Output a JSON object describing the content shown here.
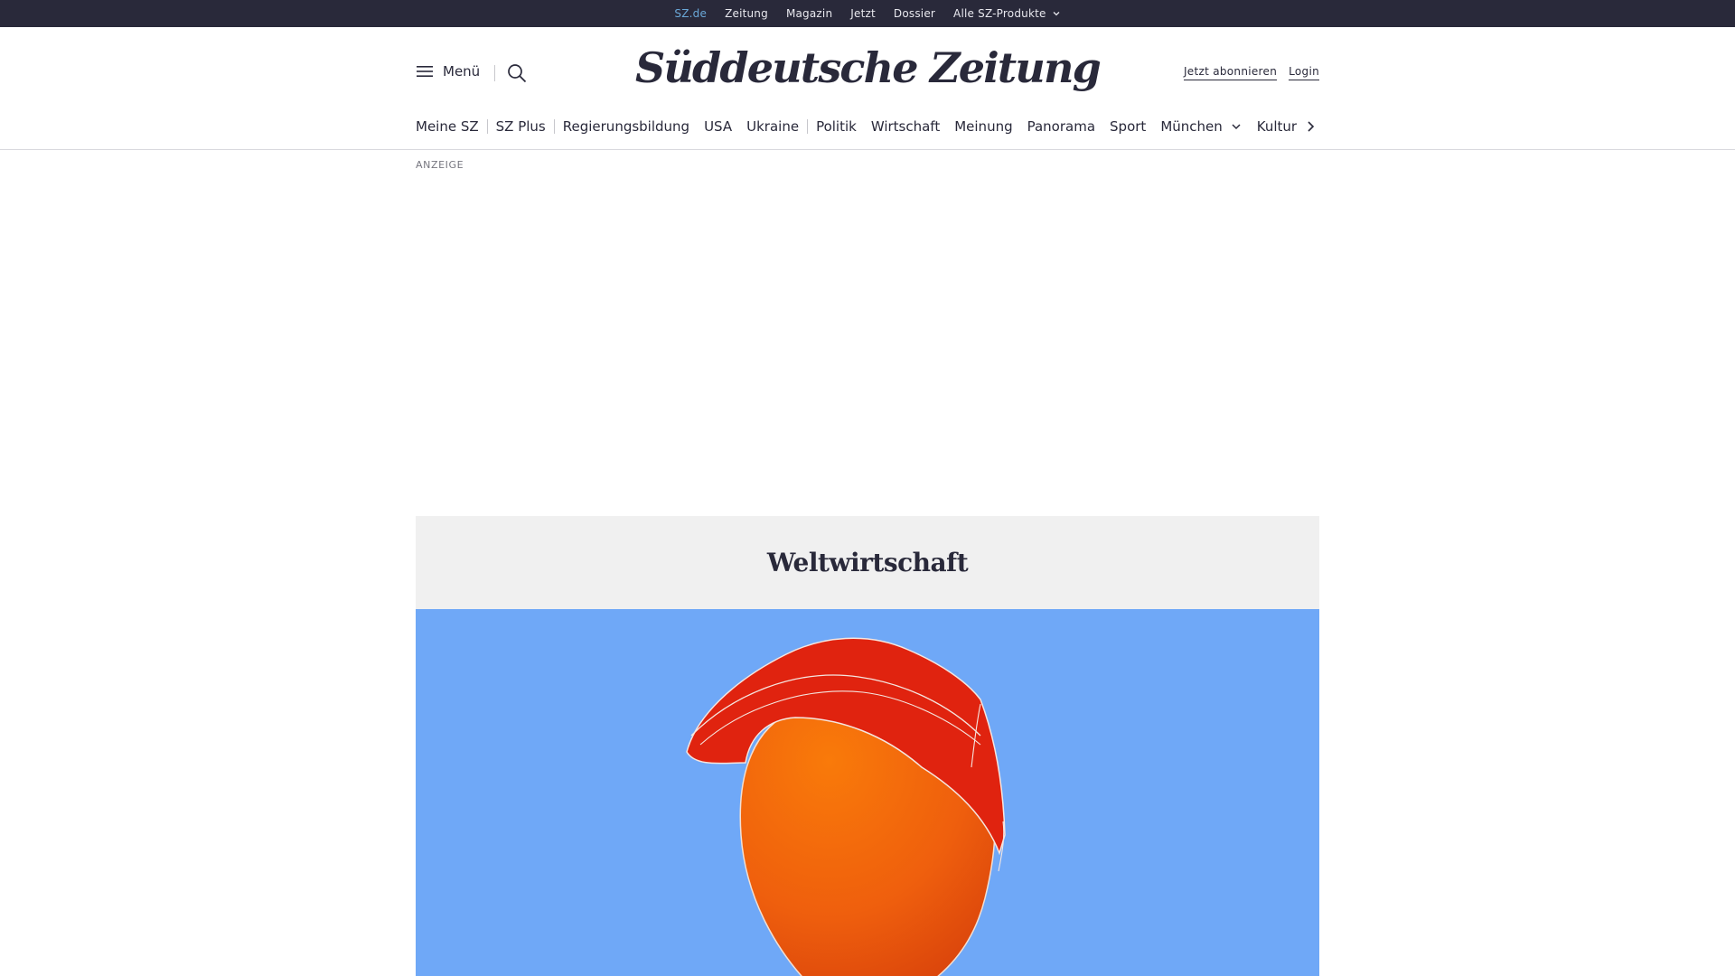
{
  "topbar": {
    "links": [
      {
        "label": "SZ.de",
        "active": true
      },
      {
        "label": "Zeitung"
      },
      {
        "label": "Magazin"
      },
      {
        "label": "Jetzt"
      },
      {
        "label": "Dossier"
      }
    ],
    "products_label": "Alle SZ-Produkte"
  },
  "header": {
    "menu_label": "Menü",
    "logo_text": "Süddeutsche Zeitung",
    "subscribe_label": "Jetzt abonnieren",
    "login_label": "Login"
  },
  "ressorts": {
    "items": [
      "Meine SZ",
      "SZ Plus",
      "Regierungsbildung",
      "USA",
      "Ukraine",
      "Politik",
      "Wirtschaft",
      "Meinung",
      "Panorama",
      "Sport",
      "München",
      "Kultur"
    ]
  },
  "ad": {
    "label": "ANZEIGE"
  },
  "teaser": {
    "kicker": "Weltwirtschaft"
  },
  "colors": {
    "topbar_bg": "#29293a",
    "active_link": "#6aa8d8",
    "card_head_bg": "#f0f0f0",
    "image_bg": "#6fa8f7",
    "cap_red": "#e0230f",
    "face_orange": "#f26a10"
  }
}
